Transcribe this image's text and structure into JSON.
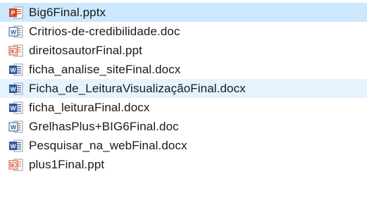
{
  "files": [
    {
      "name": "Big6Final.pptx",
      "icon": "pptx-file-icon",
      "state": "selected"
    },
    {
      "name": "Critrios-de-credibilidade.doc",
      "icon": "doc-file-icon",
      "state": "normal"
    },
    {
      "name": "direitosautorFinal.ppt",
      "icon": "ppt-file-icon",
      "state": "normal"
    },
    {
      "name": "ficha_analise_siteFinal.docx",
      "icon": "docx-file-icon",
      "state": "normal"
    },
    {
      "name": "Ficha_de_LeituraVisualizaçãoFinal.docx",
      "icon": "docx-file-icon",
      "state": "hover"
    },
    {
      "name": "ficha_leituraFinal.docx",
      "icon": "docx-file-icon",
      "state": "normal"
    },
    {
      "name": "GrelhasPlus+BIG6Final.doc",
      "icon": "doc-file-icon",
      "state": "normal"
    },
    {
      "name": "Pesquisar_na_webFinal.docx",
      "icon": "docx-file-icon",
      "state": "normal"
    },
    {
      "name": "plus1Final.ppt",
      "icon": "ppt-file-icon",
      "state": "normal"
    }
  ],
  "colors": {
    "selected_bg": "#cce8ff",
    "hover_bg": "#e5f3ff",
    "word_blue": "#2b579a",
    "powerpoint_orange": "#d24726"
  }
}
